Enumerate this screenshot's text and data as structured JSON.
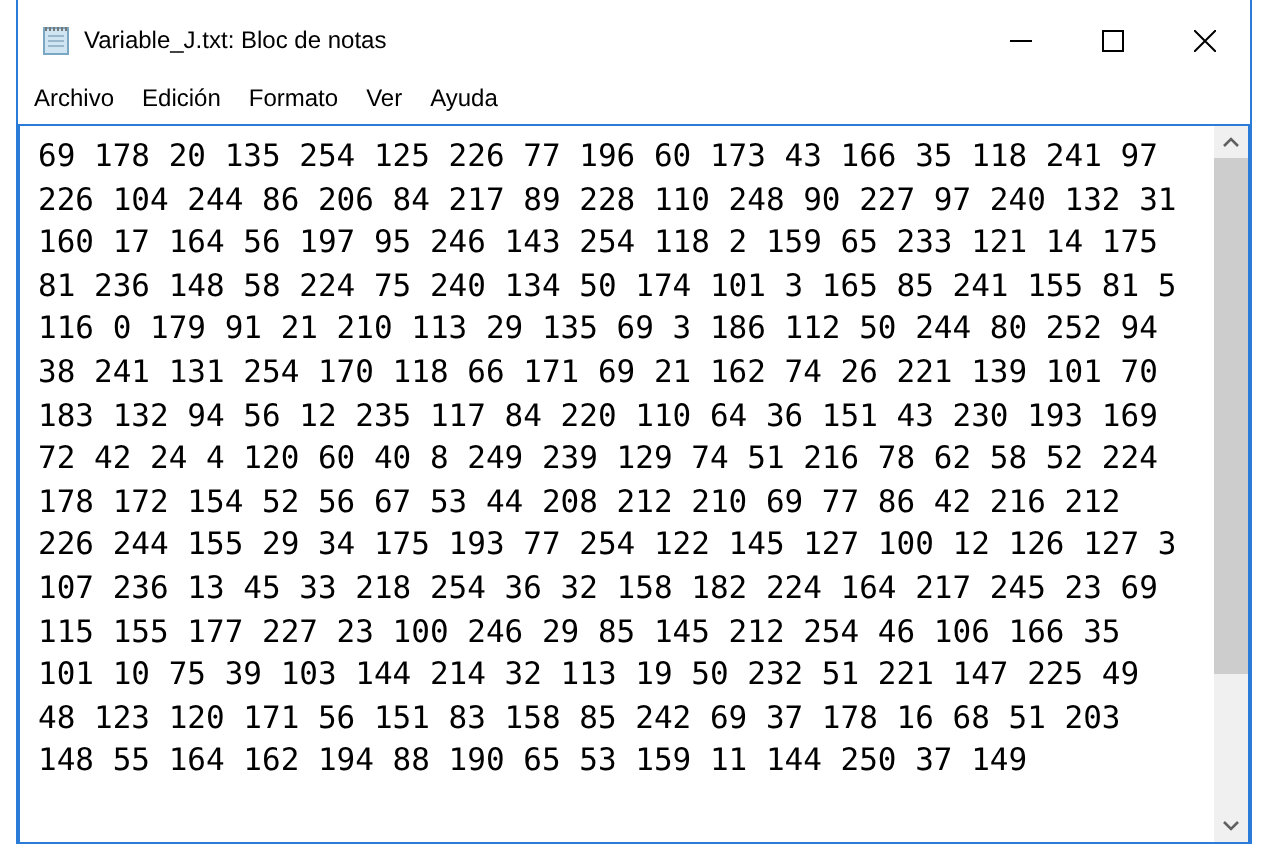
{
  "window": {
    "title": "Variable_J.txt: Bloc de notas",
    "controls": [
      {
        "kind": "minimize"
      },
      {
        "kind": "maximize"
      },
      {
        "kind": "close"
      }
    ]
  },
  "menu": [
    "Archivo",
    "Edición",
    "Formato",
    "Ver",
    "Ayuda"
  ],
  "editor": {
    "lines": [
      "69 178 20 135 254 125 226 77 196 60 173 43 166 35 118 241 97",
      "226 104 244 86 206 84 217 89 228 110 248 90 227 97 240 132 31",
      "160 17 164 56 197 95 246 143 254 118 2 159 65 233 121 14 175",
      "81 236 148 58 224 75 240 134 50 174 101 3 165 85 241 155 81 5",
      "116 0 179 91 21 210 113 29 135 69 3 186 112 50 244 80 252 94",
      "38 241 131 254 170 118 66 171 69 21 162 74 26 221 139 101 70",
      "183 132 94 56 12 235 117 84 220 110 64 36 151 43 230 193 169",
      "72 42 24 4 120 60 40 8 249 239 129 74 51 216 78 62 58 52 224",
      "178 172 154 52 56 67 53 44 208 212 210 69 77 86 42 216 212",
      "226 244 155 29 34 175 193 77 254 122 145 127 100 12 126 127 3",
      "107 236 13 45 33 218 254 36 32 158 182 224 164 217 245 23 69",
      "115 155 177 227 23 100 246 29 85 145 212 254 46 106 166 35",
      "101 10 75 39 103 144 214 32 113 19 50 232 51 221 147 225 49",
      "48 123 120 171 56 151 83 158 85 242 69 37 178 16 68 51 203",
      "148 55 164 162 194 88 190 65 53 159 11 144 250 37 149"
    ]
  }
}
